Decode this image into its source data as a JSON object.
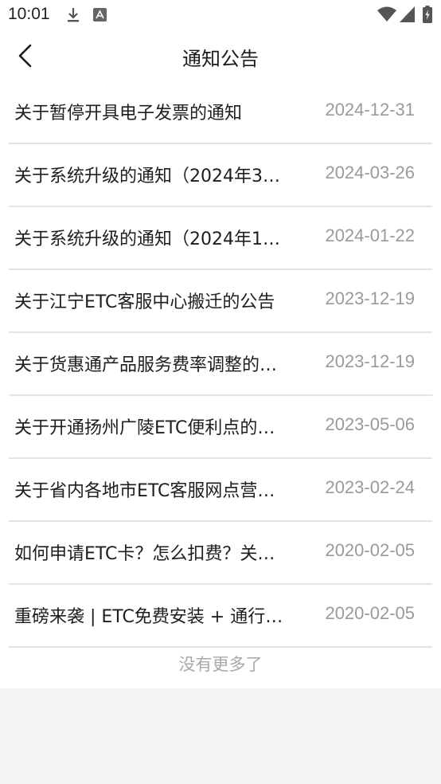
{
  "status_bar": {
    "time": "10:01"
  },
  "header": {
    "title": "通知公告"
  },
  "notices": [
    {
      "title": "关于暂停开具电子发票的通知",
      "date": "2024-12-31"
    },
    {
      "title": "关于系统升级的通知（2024年3…",
      "date": "2024-03-26"
    },
    {
      "title": "关于系统升级的通知（2024年1…",
      "date": "2024-01-22"
    },
    {
      "title": "关于江宁ETC客服中心搬迁的公告",
      "date": "2023-12-19"
    },
    {
      "title": "关于货惠通产品服务费率调整的…",
      "date": "2023-12-19"
    },
    {
      "title": "关于开通扬州广陵ETC便利点的…",
      "date": "2023-05-06"
    },
    {
      "title": "关于省内各地市ETC客服网点营…",
      "date": "2023-02-24"
    },
    {
      "title": "如何申请ETC卡？怎么扣费？关…",
      "date": "2020-02-05"
    },
    {
      "title": "重磅来袭 | ETC免费安装 + 通行…",
      "date": "2020-02-05"
    }
  ],
  "footer": {
    "no_more_text": "没有更多了"
  }
}
